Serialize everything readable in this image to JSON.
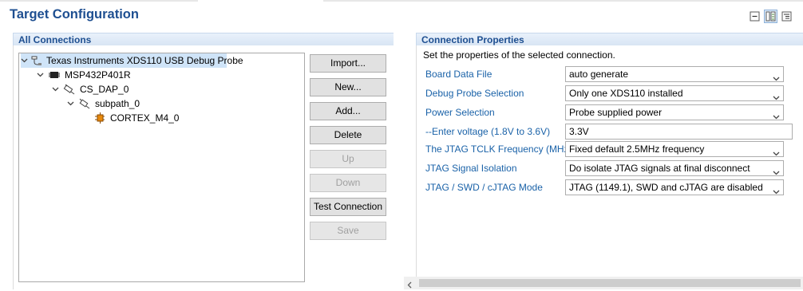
{
  "page": {
    "title": "Target Configuration"
  },
  "view_buttons": [
    {
      "icon": "collapse-all-icon"
    },
    {
      "icon": "basic-view-icon",
      "active": true
    },
    {
      "icon": "advanced-view-icon"
    }
  ],
  "connections": {
    "header": "All Connections",
    "tree": [
      {
        "label": "Texas Instruments XDS110 USB Debug Probe",
        "level": 0,
        "icon": "debug-probe-icon",
        "selected": true,
        "expanded": true
      },
      {
        "label": "MSP432P401R",
        "level": 1,
        "icon": "chip-icon",
        "expanded": true
      },
      {
        "label": "CS_DAP_0",
        "level": 2,
        "icon": "router-icon",
        "expanded": true
      },
      {
        "label": "subpath_0",
        "level": 3,
        "icon": "subpath-icon",
        "expanded": true
      },
      {
        "label": "CORTEX_M4_0",
        "level": 4,
        "icon": "cpu-core-icon",
        "expanded": false
      }
    ],
    "buttons": [
      {
        "label": "Import...",
        "enabled": true
      },
      {
        "label": "New...",
        "enabled": true
      },
      {
        "label": "Add...",
        "enabled": true
      },
      {
        "label": "Delete",
        "enabled": true
      },
      {
        "label": "Up",
        "enabled": false
      },
      {
        "label": "Down",
        "enabled": false
      },
      {
        "label": "Test Connection",
        "enabled": true
      },
      {
        "label": "Save",
        "enabled": false
      }
    ]
  },
  "properties": {
    "header": "Connection Properties",
    "description": "Set the properties of the selected connection.",
    "board_data_file": {
      "label": "Board Data File",
      "value": "auto generate"
    },
    "debug_probe_selection": {
      "label": "Debug Probe Selection",
      "value": "Only one XDS110 installed"
    },
    "power_selection": {
      "label": "Power Selection",
      "value": "Probe supplied power"
    },
    "voltage": {
      "label": "--Enter voltage (1.8V to 3.6V)",
      "value": "3.3V"
    },
    "tclk_frequency": {
      "label": "The JTAG TCLK Frequency (MHz)",
      "value": "Fixed default 2.5MHz frequency"
    },
    "signal_isolation": {
      "label": "JTAG Signal Isolation",
      "value": "Do isolate JTAG signals at final disconnect"
    },
    "jtag_mode": {
      "label": "JTAG / SWD / cJTAG Mode",
      "value": "JTAG (1149.1), SWD and cJTAG are disabled"
    }
  },
  "colors": {
    "title": "#1e4f91",
    "label": "#1a62a8",
    "selection": "#cfe4f8"
  }
}
